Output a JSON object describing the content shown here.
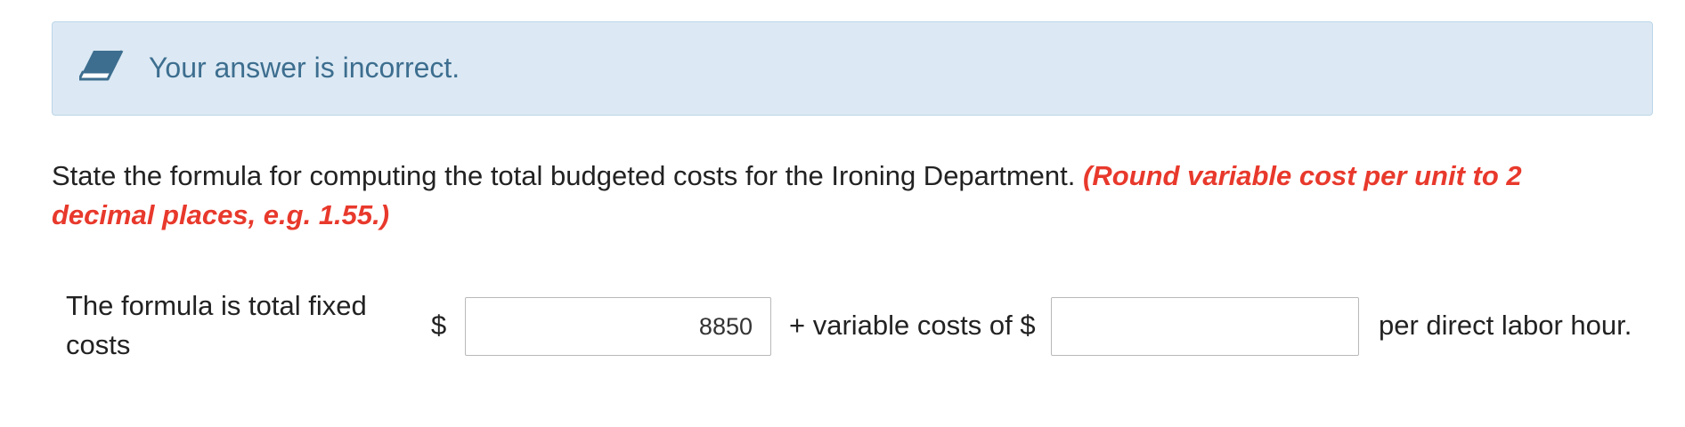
{
  "feedback": {
    "icon": "eraser-icon",
    "message": "Your answer is incorrect.",
    "colors": {
      "background": "#dce9f4",
      "text": "#3d6e8f"
    }
  },
  "question": {
    "text": "State the formula for computing the total budgeted costs for the Ironing Department.",
    "hint": "(Round variable cost per unit to 2 decimal places, e.g. 1.55.)",
    "hint_color": "#e8392c"
  },
  "formula": {
    "label": "The formula is total fixed costs",
    "fixed_currency": "$",
    "fixed_value": "8850",
    "variable_prefix": "+ variable costs of $",
    "variable_value": "",
    "suffix": "per direct labor hour."
  }
}
